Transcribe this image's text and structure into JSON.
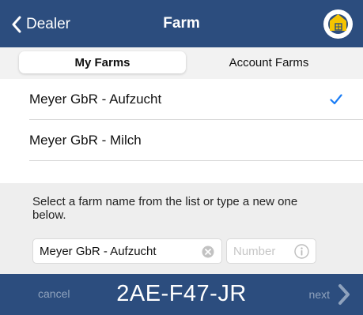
{
  "navbar": {
    "back_label": "Dealer",
    "title": "Farm",
    "back_icon": "chevron-left-icon",
    "logo_icon": "farm-logo-icon"
  },
  "segments": [
    {
      "label": "My Farms",
      "selected": true
    },
    {
      "label": "Account Farms",
      "selected": false
    }
  ],
  "farms": [
    {
      "name": "Meyer GbR - Aufzucht",
      "checked": true
    },
    {
      "name": "Meyer GbR - Milch",
      "checked": false
    }
  ],
  "form": {
    "instruction": "Select a farm name from the list or type a new one below.",
    "name_value": "Meyer GbR - Aufzucht",
    "number_placeholder": "Number",
    "clear_icon": "clear-icon",
    "info_icon": "info-icon"
  },
  "bottombar": {
    "cancel_label": "cancel",
    "code": "2AE-F47-JR",
    "next_label": "next",
    "next_icon": "chevron-right-icon"
  },
  "colors": {
    "navbar_bg": "#2c4d7e",
    "accent_blue": "#1a7cf5",
    "logo_yellow": "#f5c400"
  }
}
